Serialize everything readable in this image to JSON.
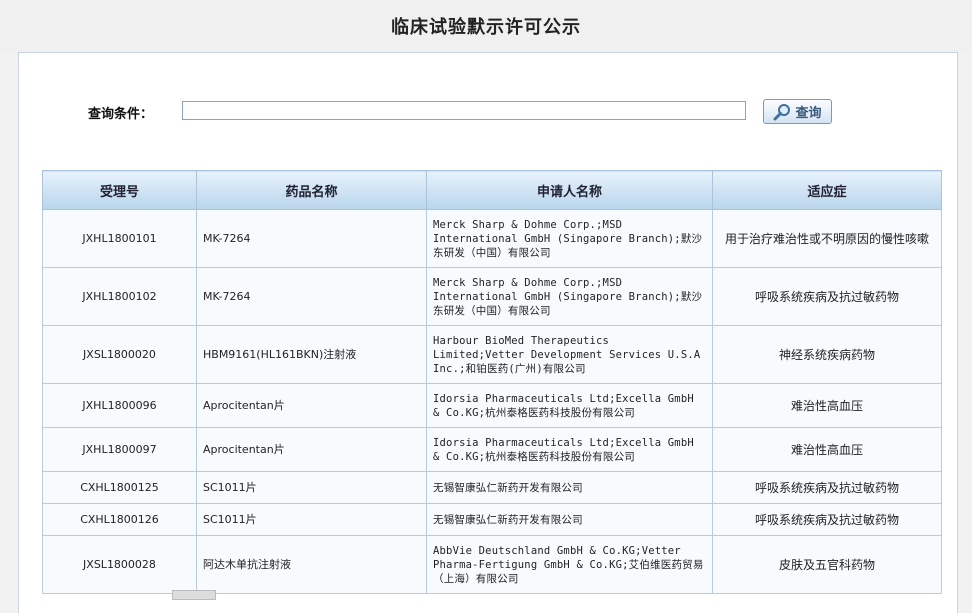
{
  "page": {
    "title": "临床试验默示许可公示"
  },
  "query": {
    "label": "查询条件：",
    "value": "",
    "button_label": "查询"
  },
  "table": {
    "headers": [
      "受理号",
      "药品名称",
      "申请人名称",
      "适应症"
    ],
    "rows": [
      {
        "id": "JXHL1800101",
        "drug": "MK-7264",
        "applicant": "Merck Sharp & Dohme Corp.;MSD International GmbH (Singapore Branch);默沙东研发（中国）有限公司",
        "indication": "用于治疗难治性或不明原因的慢性咳嗽"
      },
      {
        "id": "JXHL1800102",
        "drug": "MK-7264",
        "applicant": "Merck Sharp & Dohme Corp.;MSD International GmbH (Singapore Branch);默沙东研发（中国）有限公司",
        "indication": "呼吸系统疾病及抗过敏药物"
      },
      {
        "id": "JXSL1800020",
        "drug": "HBM9161(HL161BKN)注射液",
        "applicant": "Harbour BioMed Therapeutics Limited;Vetter Development Services U.S.A Inc.;和铂医药(广州)有限公司",
        "indication": "神经系统疾病药物"
      },
      {
        "id": "JXHL1800096",
        "drug": "Aprocitentan片",
        "applicant": "Idorsia Pharmaceuticals Ltd;Excella GmbH & Co.KG;杭州泰格医药科技股份有限公司",
        "indication": "难治性高血压"
      },
      {
        "id": "JXHL1800097",
        "drug": "Aprocitentan片",
        "applicant": "Idorsia Pharmaceuticals Ltd;Excella GmbH & Co.KG;杭州泰格医药科技股份有限公司",
        "indication": "难治性高血压"
      },
      {
        "id": "CXHL1800125",
        "drug": "SC1011片",
        "applicant": "无锡智康弘仁新药开发有限公司",
        "indication": "呼吸系统疾病及抗过敏药物"
      },
      {
        "id": "CXHL1800126",
        "drug": "SC1011片",
        "applicant": "无锡智康弘仁新药开发有限公司",
        "indication": "呼吸系统疾病及抗过敏药物"
      },
      {
        "id": "JXSL1800028",
        "drug": "阿达木单抗注射液",
        "applicant": "AbbVie Deutschland GmbH & Co.KG;Vetter Pharma-Fertigung GmbH & Co.KG;艾伯维医药贸易（上海）有限公司",
        "indication": "皮肤及五官科药物"
      }
    ]
  }
}
